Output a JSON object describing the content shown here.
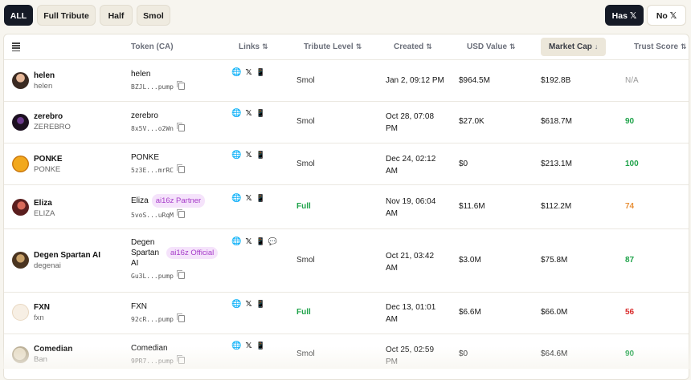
{
  "filters": {
    "all": "ALL",
    "full_tribute": "Full Tribute",
    "half": "Half",
    "smol": "Smol",
    "has_x": "Has 𝕏",
    "no_x": "No 𝕏"
  },
  "table": {
    "headers": {
      "token": "Token (CA)",
      "links": "Links",
      "tribute": "Tribute Level",
      "created": "Created",
      "usd": "USD Value",
      "mcap": "Market Cap",
      "trust": "Trust Score"
    },
    "sort_glyph": "⇅",
    "sorted_glyph": "↓",
    "rows": [
      {
        "name": "helen",
        "ticker": "helen",
        "token": "helen",
        "badge": "",
        "ca": "BZJL...pump",
        "tribute": "Smol",
        "created1": "Jan 2, 09:12 PM",
        "created2": "",
        "usd": "$964.5M",
        "mcap": "$192.8B",
        "trust": "N/A"
      },
      {
        "name": "zerebro",
        "ticker": "ZEREBRO",
        "token": "zerebro",
        "badge": "",
        "ca": "8x5V...o2Wn",
        "tribute": "Smol",
        "created1": "Oct 28, 07:08",
        "created2": "PM",
        "usd": "$27.0K",
        "mcap": "$618.7M",
        "trust": "90"
      },
      {
        "name": "PONKE",
        "ticker": "PONKE",
        "token": "PONKE",
        "badge": "",
        "ca": "5z3E...mrRC",
        "tribute": "Smol",
        "created1": "Dec 24, 02:12",
        "created2": "AM",
        "usd": "$0",
        "mcap": "$213.1M",
        "trust": "100"
      },
      {
        "name": "Eliza",
        "ticker": "ELIZA",
        "token": "Eliza",
        "badge": "ai16z Partner",
        "ca": "5voS...uRqM",
        "tribute": "Full",
        "created1": "Nov 19, 06:04",
        "created2": "AM",
        "usd": "$11.6M",
        "mcap": "$112.2M",
        "trust": "74"
      },
      {
        "name": "Degen Spartan AI",
        "ticker": "degenai",
        "token": "Degen Spartan AI",
        "badge": "ai16z Official",
        "ca": "Gu3L...pump",
        "tribute": "Smol",
        "created1": "Oct 21, 03:42",
        "created2": "AM",
        "usd": "$3.0M",
        "mcap": "$75.8M",
        "trust": "87"
      },
      {
        "name": "FXN",
        "ticker": "fxn",
        "token": "FXN",
        "badge": "",
        "ca": "92cR...pump",
        "tribute": "Full",
        "created1": "Dec 13, 01:01",
        "created2": "AM",
        "usd": "$6.6M",
        "mcap": "$66.0M",
        "trust": "56"
      },
      {
        "name": "Comedian",
        "ticker": "Ban",
        "token": "Comedian",
        "badge": "",
        "ca": "9PR7...pump",
        "tribute": "Smol",
        "created1": "Oct 25, 02:59",
        "created2": "PM",
        "usd": "$0",
        "mcap": "$64.6M",
        "trust": "90"
      }
    ]
  },
  "icons": {
    "globe": "🌐",
    "x": "𝕏",
    "phone": "📱",
    "chat": "💬"
  },
  "colors": {
    "trust_high": "#1fa34a",
    "trust_mid": "#e8913a",
    "trust_low": "#d92b2b",
    "trust_na": "#9a9a9a",
    "full": "#1fa34a"
  }
}
